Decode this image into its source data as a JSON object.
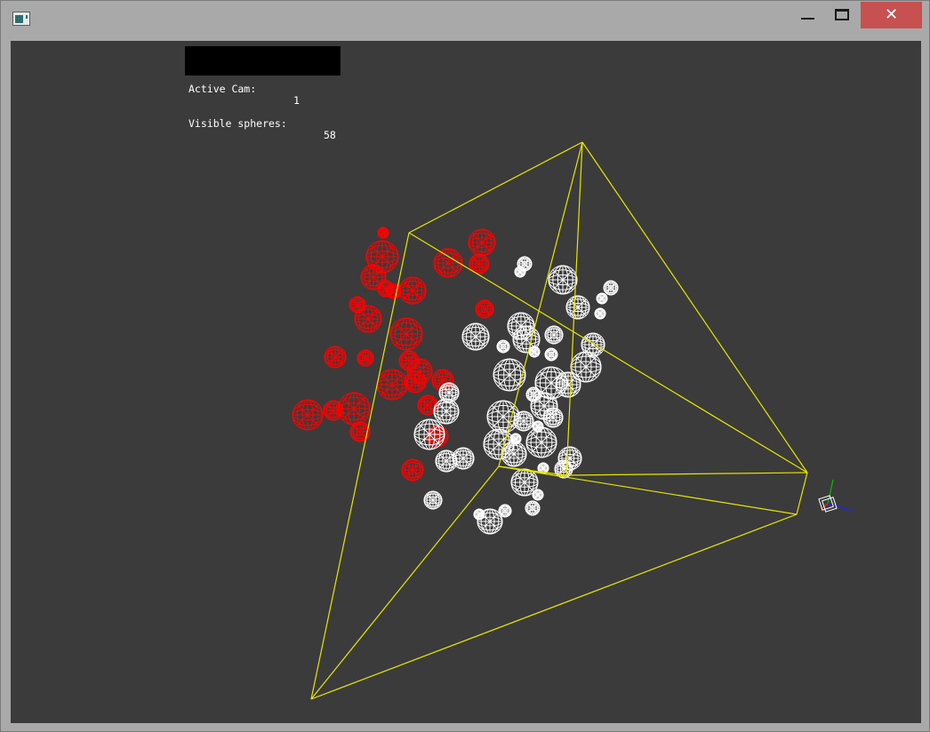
{
  "window": {
    "title": "",
    "icon": "app-window-icon",
    "controls": {
      "minimize_icon": "minimize-icon",
      "maximize_icon": "maximize-icon",
      "close_glyph": "✕",
      "close_color": "#c75050"
    }
  },
  "viewport": {
    "background": "#3b3b3b",
    "hud": {
      "active_cam_label": "Active Cam:",
      "active_cam_value": "1",
      "visible_spheres_label": "Visible spheres:",
      "visible_spheres_value": "58"
    },
    "colors": {
      "frustum": "#e6e600",
      "visible_sphere": "#ffffff",
      "culled_sphere": "#ff0000",
      "axis_x": "#2020ff",
      "axis_y": "#00c000",
      "axis_z": "#ff2020"
    }
  }
}
